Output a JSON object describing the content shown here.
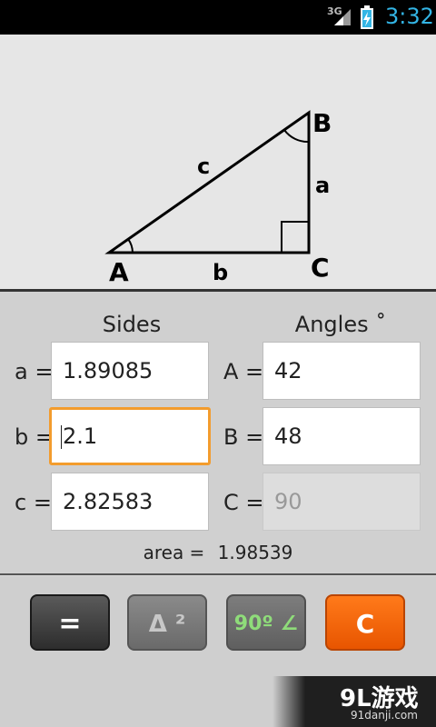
{
  "status": {
    "network": "3G",
    "time": "3:32"
  },
  "diagram": {
    "vertex_a": "A",
    "vertex_b": "B",
    "vertex_c": "C",
    "side_a": "a",
    "side_b": "b",
    "side_c": "c"
  },
  "sides": {
    "heading": "Sides",
    "a_label": "a =",
    "a_value": "1.89085",
    "b_label": "b =",
    "b_value": "2.1",
    "c_label": "c =",
    "c_value": "2.82583"
  },
  "angles": {
    "heading": "Angles ˚",
    "A_label": "A =",
    "A_value": "42",
    "B_label": "B =",
    "B_value": "48",
    "C_label": "C =",
    "C_value": "90"
  },
  "area": {
    "label": "area =",
    "value": "1.98539"
  },
  "buttons": {
    "equals": "=",
    "delta": "Δ ²",
    "right_angle": "90º ∠",
    "clear": "C"
  },
  "watermark": {
    "brand": "9L游戏",
    "site": "91danji.com"
  },
  "colors": {
    "accent": "#33b5e5",
    "focus": "#f39c2d",
    "clear_button": "#f06000"
  }
}
